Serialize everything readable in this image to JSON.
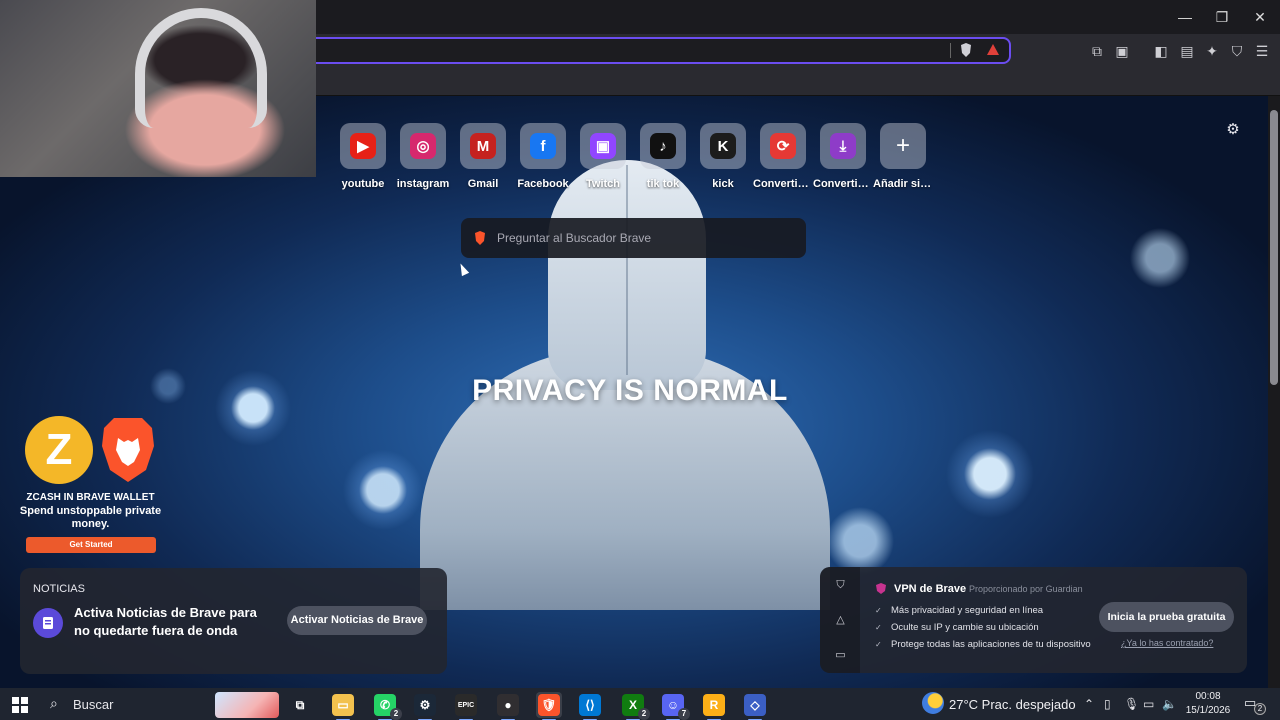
{
  "window": {
    "minimize_glyph": "—",
    "maximize_glyph": "❐",
    "close_glyph": "✕"
  },
  "toolbar": {
    "icons": [
      "extensions-icon",
      "screenshot-icon",
      "sidebar-icon",
      "wallet-icon",
      "leo-ai-icon",
      "vpn-icon",
      "menu-icon"
    ]
  },
  "top_sites": [
    {
      "label": "youtube",
      "icon": "youtube-icon",
      "glyph": "▶",
      "color": "#e62117"
    },
    {
      "label": "instagram",
      "icon": "instagram-icon",
      "glyph": "◎",
      "color": "#d6286d"
    },
    {
      "label": "Gmail",
      "icon": "gmail-icon",
      "glyph": "M",
      "color": "#c5221f"
    },
    {
      "label": "Facebook",
      "icon": "facebook-icon",
      "glyph": "f",
      "color": "#1877f2"
    },
    {
      "label": "Twitch",
      "icon": "twitch-icon",
      "glyph": "▣",
      "color": "#9146ff"
    },
    {
      "label": "tik tok",
      "icon": "tiktok-icon",
      "glyph": "♪",
      "color": "#111111"
    },
    {
      "label": "kick",
      "icon": "kick-icon",
      "glyph": "K",
      "color": "#1c1c1c"
    },
    {
      "label": "Convertido...",
      "icon": "converter-icon",
      "glyph": "⟳",
      "color": "#e53935"
    },
    {
      "label": "Convertido...",
      "icon": "download-icon",
      "glyph": "⤓",
      "color": "#8e3cc8"
    },
    {
      "label": "Añadir sitio",
      "icon": "plus-icon",
      "glyph": "+",
      "color": "transparent"
    }
  ],
  "search": {
    "placeholder": "Preguntar al Buscador Brave"
  },
  "background": {
    "headline": "PRIVACY IS NORMAL"
  },
  "promo": {
    "coin_glyph": "Z",
    "title": "ZCASH IN BRAVE WALLET",
    "subtitle": "Spend unstoppable private money.",
    "button": "Get Started"
  },
  "news": {
    "heading": "NOTICIAS",
    "text": "Activa Noticias de Brave para no quedarte fuera de onda",
    "button": "Activar Noticias de Brave"
  },
  "vpn": {
    "title": "VPN de Brave",
    "powered_by": "Proporcionado por",
    "provider": "Guardian",
    "features": [
      "Más privacidad y seguridad en línea",
      "Oculte su IP y cambie su ubicación",
      "Protege todas las aplicaciones de tu dispositivo"
    ],
    "button": "Inicia la prueba gratuita",
    "link": "¿Ya lo has contratado?"
  },
  "taskbar": {
    "search_text": "Buscar",
    "apps": [
      {
        "name": "task-view-icon",
        "glyph": "⧉",
        "color": "transparent",
        "badge": ""
      },
      {
        "name": "file-explorer-icon",
        "glyph": "▭",
        "color": "#f2c14e",
        "badge": ""
      },
      {
        "name": "whatsapp-icon",
        "glyph": "✆",
        "color": "#25d366",
        "badge": "2"
      },
      {
        "name": "steam-icon",
        "glyph": "⚙",
        "color": "#1b2838",
        "badge": ""
      },
      {
        "name": "epic-games-icon",
        "glyph": "EPIC",
        "color": "#2a2a2a",
        "badge": ""
      },
      {
        "name": "obs-icon",
        "glyph": "●",
        "color": "#302e31",
        "badge": ""
      },
      {
        "name": "brave-icon",
        "glyph": "🛡",
        "color": "#fb542b",
        "badge": ""
      },
      {
        "name": "vscode-icon",
        "glyph": "⟨⟩",
        "color": "#0078d4",
        "badge": ""
      },
      {
        "name": "xbox-icon",
        "glyph": "X",
        "color": "#107c10",
        "badge": "2"
      },
      {
        "name": "discord-icon",
        "glyph": "☺",
        "color": "#5865f2",
        "badge": "7"
      },
      {
        "name": "rockstar-icon",
        "glyph": "R",
        "color": "#fcaf17",
        "badge": ""
      },
      {
        "name": "settings-app-icon",
        "glyph": "◇",
        "color": "#3b5fc4",
        "badge": ""
      }
    ],
    "weather": "27°C  Prac. despejado",
    "time": "00:08",
    "date": "15/1/2026",
    "notifications": "2"
  }
}
